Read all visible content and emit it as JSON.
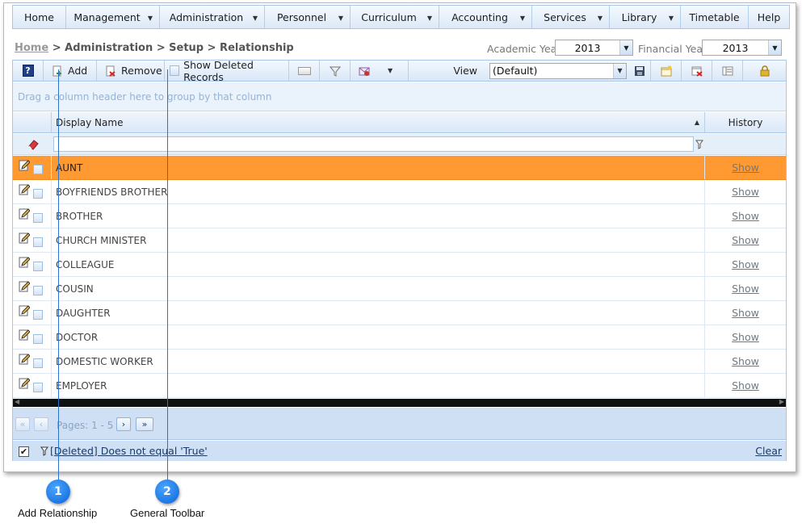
{
  "nav": {
    "items": [
      {
        "label": "Home",
        "caret": false
      },
      {
        "label": "Management",
        "caret": true
      },
      {
        "label": "Administration",
        "caret": true
      },
      {
        "label": "Personnel",
        "caret": true
      },
      {
        "label": "Curriculum",
        "caret": true
      },
      {
        "label": "Accounting",
        "caret": true
      },
      {
        "label": "Services",
        "caret": true
      },
      {
        "label": "Library",
        "caret": true
      },
      {
        "label": "Timetable",
        "caret": false
      },
      {
        "label": "Help",
        "caret": false
      }
    ]
  },
  "breadcrumb": {
    "home": "Home",
    "sep": " > ",
    "rest": "Administration > Setup > Relationship"
  },
  "years": {
    "academic_label": "Academic Year",
    "academic_value": "2013",
    "financial_label": "Financial Year",
    "financial_value": "2013"
  },
  "toolbar": {
    "add_label": "Add",
    "remove_label": "Remove",
    "show_deleted_label": "Show Deleted Records",
    "view_label": "View",
    "view_value": "(Default)"
  },
  "grid": {
    "group_hint": "Drag a column header here to group by that column",
    "columns": {
      "display_name": "Display Name",
      "history": "History"
    },
    "link_text": "Show",
    "rows": [
      "AUNT",
      "BOYFRIENDS BROTHER",
      "BROTHER",
      "CHURCH MINISTER",
      "COLLEAGUE",
      "COUSIN",
      "DAUGHTER",
      "DOCTOR",
      "DOMESTIC WORKER",
      "EMPLOYER"
    ],
    "selected_row": 0
  },
  "pager": {
    "label": "Pages: 1 - 5"
  },
  "status": {
    "filter_text": "[Deleted] Does not equal 'True'",
    "clear_label": "Clear"
  },
  "callouts": [
    {
      "number": "1",
      "label": "Add Relationship"
    },
    {
      "number": "2",
      "label": "General Toolbar"
    }
  ],
  "colors": {
    "selected_row": "#ff9a33",
    "callout": "#0b63d6",
    "link": "#1b3a64"
  }
}
